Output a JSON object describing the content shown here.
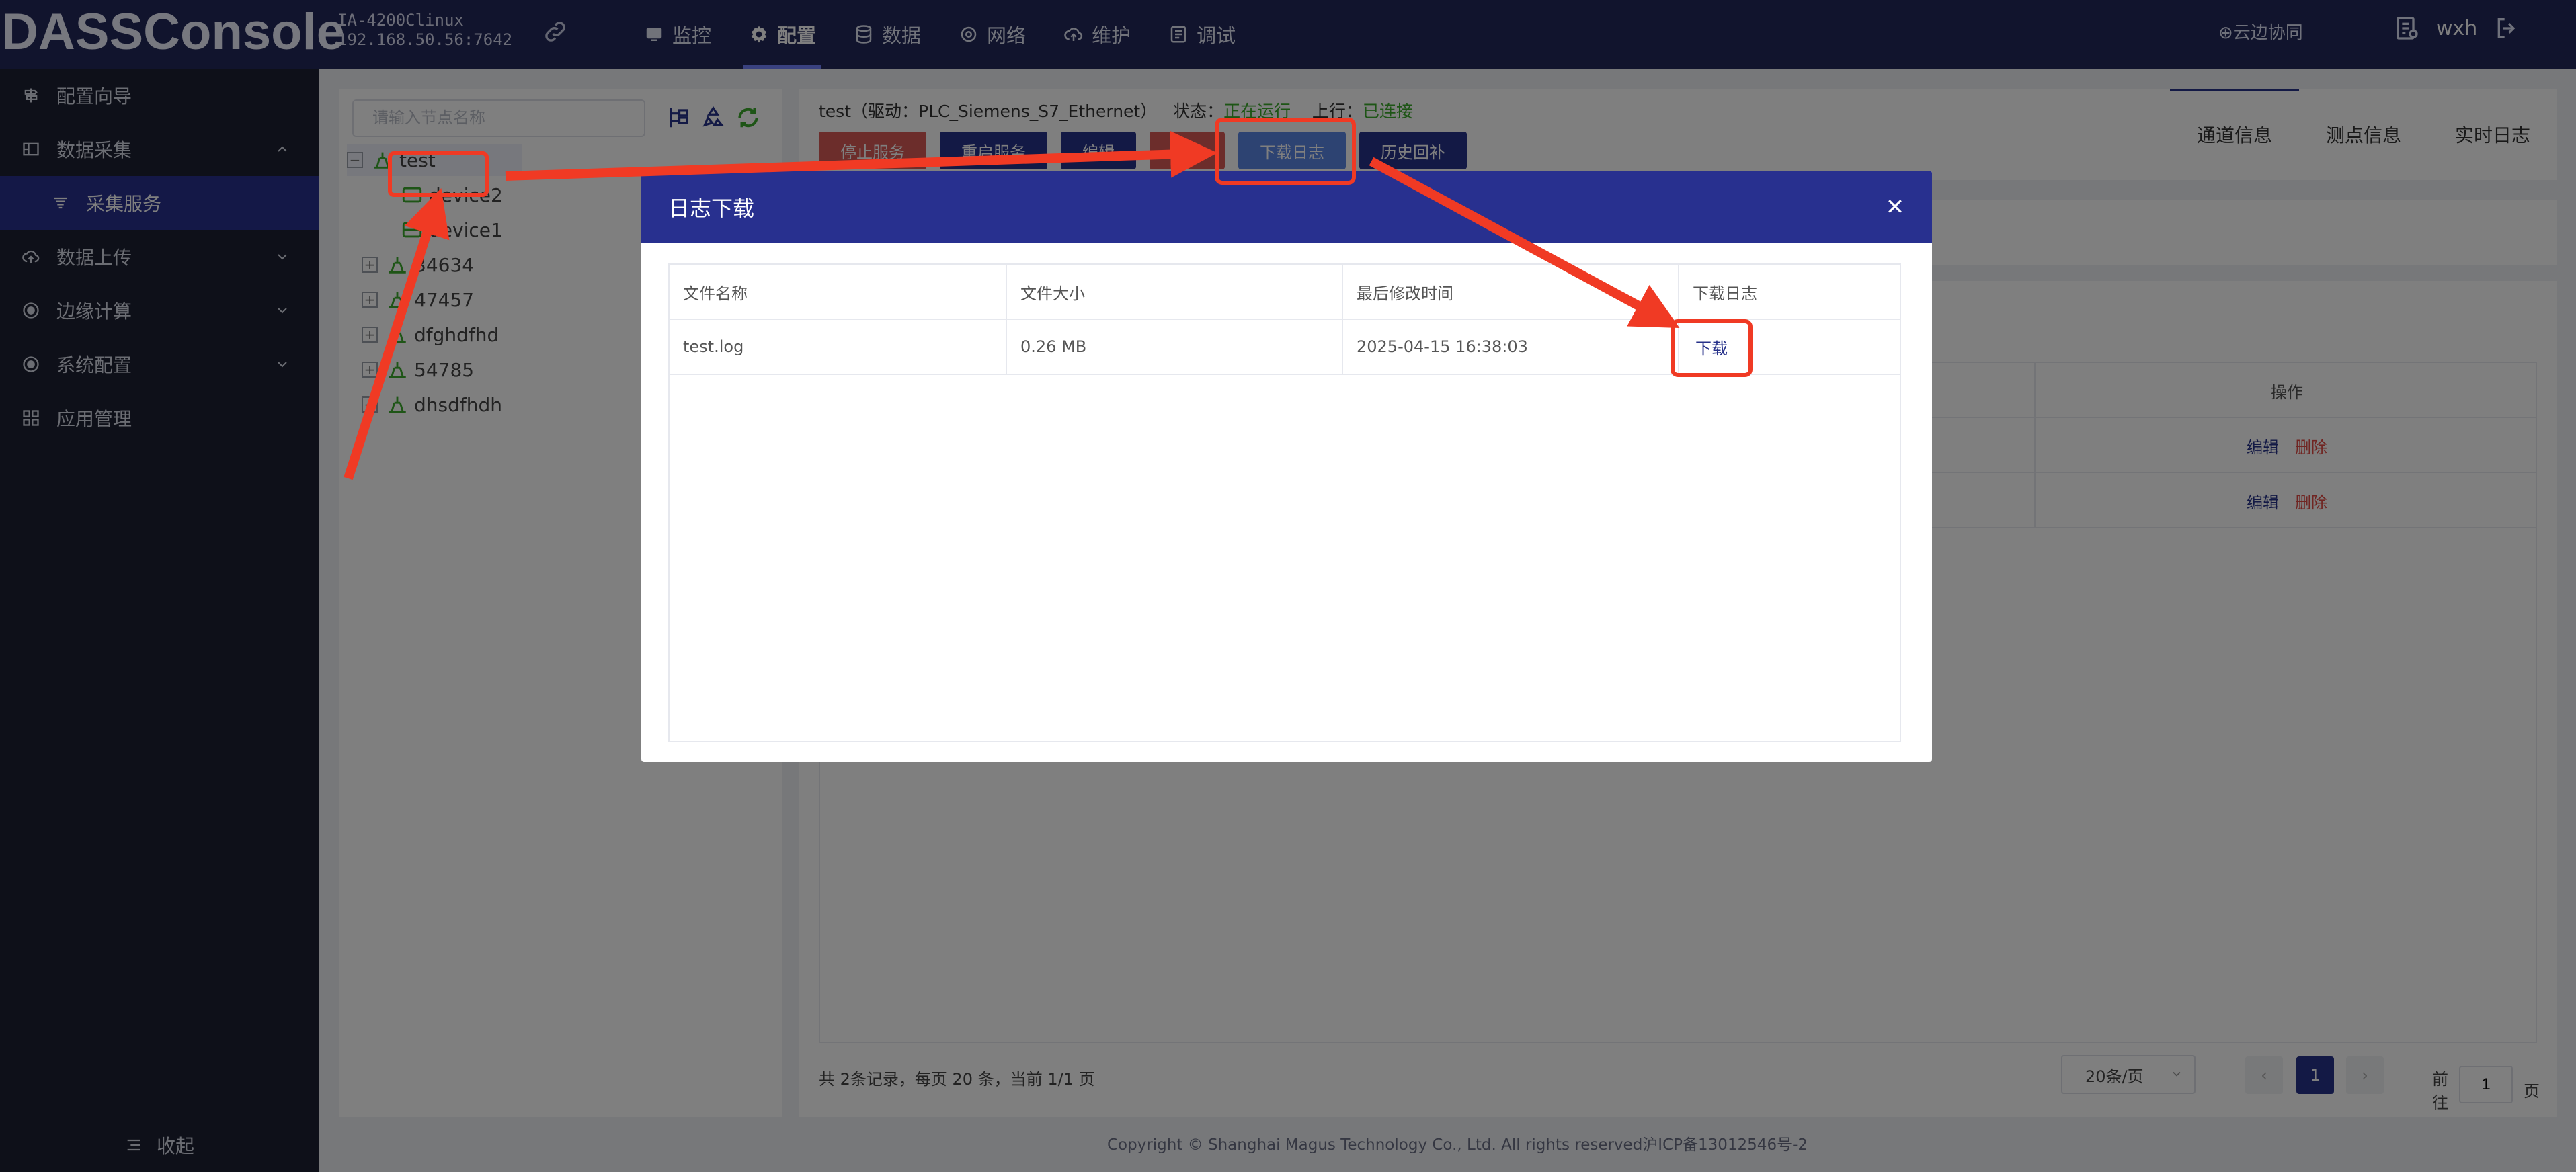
{
  "header": {
    "logo": "DASSConsole",
    "device_model": "IA-4200Clinux",
    "device_ip": "192.168.50.56:7642",
    "nav": [
      {
        "label": "监控"
      },
      {
        "label": "配置"
      },
      {
        "label": "数据"
      },
      {
        "label": "网络"
      },
      {
        "label": "维护"
      },
      {
        "label": "调试"
      }
    ],
    "cloud_label": "⊕云边协同",
    "user": "wxh"
  },
  "sidebar": {
    "items": [
      {
        "label": "配置向导"
      },
      {
        "label": "数据采集"
      },
      {
        "label": "采集服务"
      },
      {
        "label": "数据上传"
      },
      {
        "label": "边缘计算"
      },
      {
        "label": "系统配置"
      },
      {
        "label": "应用管理"
      }
    ],
    "collapse_label": "收起"
  },
  "tree": {
    "search_placeholder": "请输入节点名称",
    "nodes": [
      {
        "label": "test"
      },
      {
        "label": "device2"
      },
      {
        "label": "device1"
      },
      {
        "label": "34634"
      },
      {
        "label": "47457"
      },
      {
        "label": "dfghdfhd"
      },
      {
        "label": "54785"
      },
      {
        "label": "dhsdfhdh"
      }
    ]
  },
  "service": {
    "name_line": "test（驱动：PLC_Siemens_S7_Ethernet）",
    "status_label": "状态：",
    "status_value": "正在运行",
    "uplink_label": "上行：",
    "uplink_value": "已连接",
    "buttons": [
      "停止服务",
      "重启服务",
      "编辑",
      "删除",
      "下载日志",
      "历史回补"
    ]
  },
  "tabs": [
    "通道信息",
    "测点信息",
    "实时日志"
  ],
  "channel_table": {
    "op_header": "操作",
    "edit_label": "编辑",
    "delete_label": "删除",
    "rows": 2
  },
  "pagination": {
    "summary": "共 2条记录，每页 20 条，当前 1/1 页",
    "page_size": "20条/页",
    "current_page": "1",
    "goto_label": "前往",
    "goto_value": "1",
    "page_unit": "页"
  },
  "footer": "Copyright © Shanghai Magus Technology Co., Ltd. All rights reserved沪ICP备13012546号-2",
  "dialog": {
    "title": "日志下载",
    "columns": [
      "文件名称",
      "文件大小",
      "最后修改时间",
      "下载日志"
    ],
    "rows": [
      {
        "name": "test.log",
        "size": "0.26 MB",
        "modified": "2025-04-15 16:38:03",
        "action": "下载"
      }
    ]
  },
  "colors": {
    "header_bg": "#23285a",
    "sidebar_bg": "#1d2133",
    "primary": "#27328a",
    "danger": "#d85a56",
    "success": "#3dab2d",
    "annotation": "#f03a24"
  }
}
